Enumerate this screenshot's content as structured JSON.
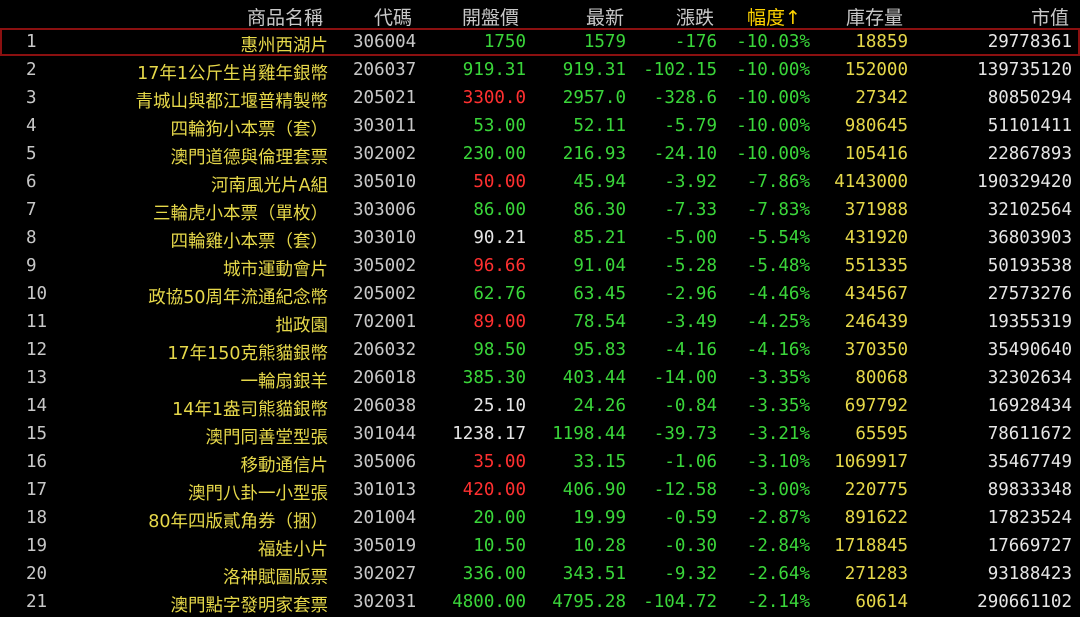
{
  "headers": {
    "name": "商品名稱",
    "code": "代碼",
    "open": "開盤價",
    "last": "最新",
    "change": "漲跌",
    "pct": "幅度↑",
    "stock": "庫存量",
    "mv": "市值"
  },
  "colors": {
    "up": "#ff3030",
    "down": "#3ad63a",
    "flat": "#e6e6e6",
    "name": "#e6d84a",
    "sort": "#ffd400"
  },
  "rows": [
    {
      "idx": "1",
      "name": "惠州西湖片",
      "code": "306004",
      "open": "1750",
      "open_color": "g",
      "last": "1579",
      "change": "-176",
      "pct": "-10.03%",
      "stock": "18859",
      "mv": "29778361"
    },
    {
      "idx": "2",
      "name": "17年1公斤生肖雞年銀幣",
      "code": "206037",
      "open": "919.31",
      "open_color": "g",
      "last": "919.31",
      "change": "-102.15",
      "pct": "-10.00%",
      "stock": "152000",
      "mv": "139735120"
    },
    {
      "idx": "3",
      "name": "青城山與都江堰普精製幣",
      "code": "205021",
      "open": "3300.0",
      "open_color": "r",
      "last": "2957.0",
      "change": "-328.6",
      "pct": "-10.00%",
      "stock": "27342",
      "mv": "80850294"
    },
    {
      "idx": "4",
      "name": "四輪狗小本票（套）",
      "code": "303011",
      "open": "53.00",
      "open_color": "g",
      "last": "52.11",
      "change": "-5.79",
      "pct": "-10.00%",
      "stock": "980645",
      "mv": "51101411"
    },
    {
      "idx": "5",
      "name": "澳門道德與倫理套票",
      "code": "302002",
      "open": "230.00",
      "open_color": "g",
      "last": "216.93",
      "change": "-24.10",
      "pct": "-10.00%",
      "stock": "105416",
      "mv": "22867893"
    },
    {
      "idx": "6",
      "name": "河南風光片A組",
      "code": "305010",
      "open": "50.00",
      "open_color": "r",
      "last": "45.94",
      "change": "-3.92",
      "pct": "-7.86%",
      "stock": "4143000",
      "mv": "190329420"
    },
    {
      "idx": "7",
      "name": "三輪虎小本票（單枚）",
      "code": "303006",
      "open": "86.00",
      "open_color": "g",
      "last": "86.30",
      "change": "-7.33",
      "pct": "-7.83%",
      "stock": "371988",
      "mv": "32102564"
    },
    {
      "idx": "8",
      "name": "四輪雞小本票（套）",
      "code": "303010",
      "open": "90.21",
      "open_color": "w",
      "last": "85.21",
      "change": "-5.00",
      "pct": "-5.54%",
      "stock": "431920",
      "mv": "36803903"
    },
    {
      "idx": "9",
      "name": "城市運動會片",
      "code": "305002",
      "open": "96.66",
      "open_color": "r",
      "last": "91.04",
      "change": "-5.28",
      "pct": "-5.48%",
      "stock": "551335",
      "mv": "50193538"
    },
    {
      "idx": "10",
      "name": "政協50周年流通紀念幣",
      "code": "205002",
      "open": "62.76",
      "open_color": "g",
      "last": "63.45",
      "change": "-2.96",
      "pct": "-4.46%",
      "stock": "434567",
      "mv": "27573276"
    },
    {
      "idx": "11",
      "name": "拙政園",
      "code": "702001",
      "open": "89.00",
      "open_color": "r",
      "last": "78.54",
      "change": "-3.49",
      "pct": "-4.25%",
      "stock": "246439",
      "mv": "19355319"
    },
    {
      "idx": "12",
      "name": "17年150克熊貓銀幣",
      "code": "206032",
      "open": "98.50",
      "open_color": "g",
      "last": "95.83",
      "change": "-4.16",
      "pct": "-4.16%",
      "stock": "370350",
      "mv": "35490640"
    },
    {
      "idx": "13",
      "name": "一輪扇銀羊",
      "code": "206018",
      "open": "385.30",
      "open_color": "g",
      "last": "403.44",
      "change": "-14.00",
      "pct": "-3.35%",
      "stock": "80068",
      "mv": "32302634"
    },
    {
      "idx": "14",
      "name": "14年1盎司熊貓銀幣",
      "code": "206038",
      "open": "25.10",
      "open_color": "w",
      "last": "24.26",
      "change": "-0.84",
      "pct": "-3.35%",
      "stock": "697792",
      "mv": "16928434"
    },
    {
      "idx": "15",
      "name": "澳門同善堂型張",
      "code": "301044",
      "open": "1238.17",
      "open_color": "w",
      "last": "1198.44",
      "change": "-39.73",
      "pct": "-3.21%",
      "stock": "65595",
      "mv": "78611672"
    },
    {
      "idx": "16",
      "name": "移動通信片",
      "code": "305006",
      "open": "35.00",
      "open_color": "r",
      "last": "33.15",
      "change": "-1.06",
      "pct": "-3.10%",
      "stock": "1069917",
      "mv": "35467749"
    },
    {
      "idx": "17",
      "name": "澳門八卦一小型張",
      "code": "301013",
      "open": "420.00",
      "open_color": "r",
      "last": "406.90",
      "change": "-12.58",
      "pct": "-3.00%",
      "stock": "220775",
      "mv": "89833348"
    },
    {
      "idx": "18",
      "name": "80年四版貳角券（捆）",
      "code": "201004",
      "open": "20.00",
      "open_color": "g",
      "last": "19.99",
      "change": "-0.59",
      "pct": "-2.87%",
      "stock": "891622",
      "mv": "17823524"
    },
    {
      "idx": "19",
      "name": "福娃小片",
      "code": "305019",
      "open": "10.50",
      "open_color": "g",
      "last": "10.28",
      "change": "-0.30",
      "pct": "-2.84%",
      "stock": "1718845",
      "mv": "17669727"
    },
    {
      "idx": "20",
      "name": "洛神賦圖版票",
      "code": "302027",
      "open": "336.00",
      "open_color": "g",
      "last": "343.51",
      "change": "-9.32",
      "pct": "-2.64%",
      "stock": "271283",
      "mv": "93188423"
    },
    {
      "idx": "21",
      "name": "澳門點字發明家套票",
      "code": "302031",
      "open": "4800.00",
      "open_color": "g",
      "last": "4795.28",
      "change": "-104.72",
      "pct": "-2.14%",
      "stock": "60614",
      "mv": "290661102"
    }
  ]
}
